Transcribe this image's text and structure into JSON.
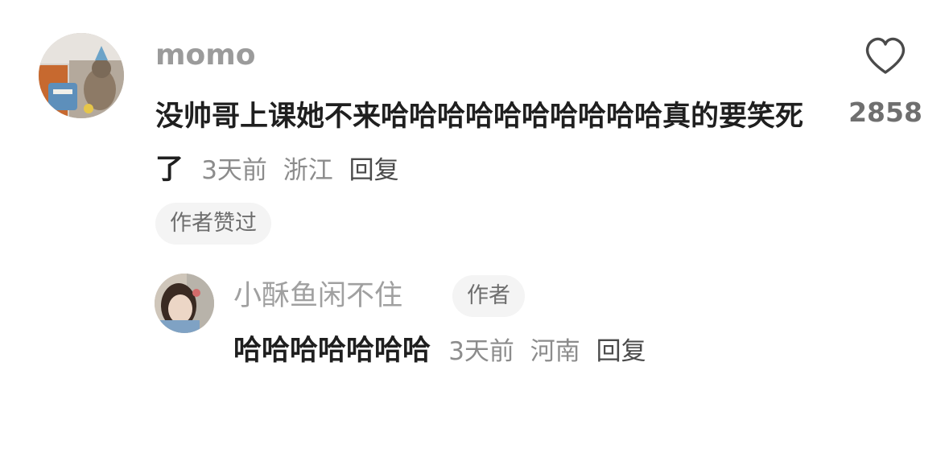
{
  "comment": {
    "username": "momo",
    "text": "没帅哥上课她不来哈哈哈哈哈哈哈哈哈哈真的要笑死了",
    "time": "3天前",
    "location": "浙江",
    "reply_label": "回复",
    "like_count": "2858",
    "like_icon": "heart-outline-icon",
    "author_liked_badge": "作者赞过"
  },
  "reply": {
    "username": "小酥鱼闲不住",
    "author_badge": "作者",
    "text": "哈哈哈哈哈哈哈",
    "time": "3天前",
    "location": "河南",
    "reply_label": "回复"
  }
}
